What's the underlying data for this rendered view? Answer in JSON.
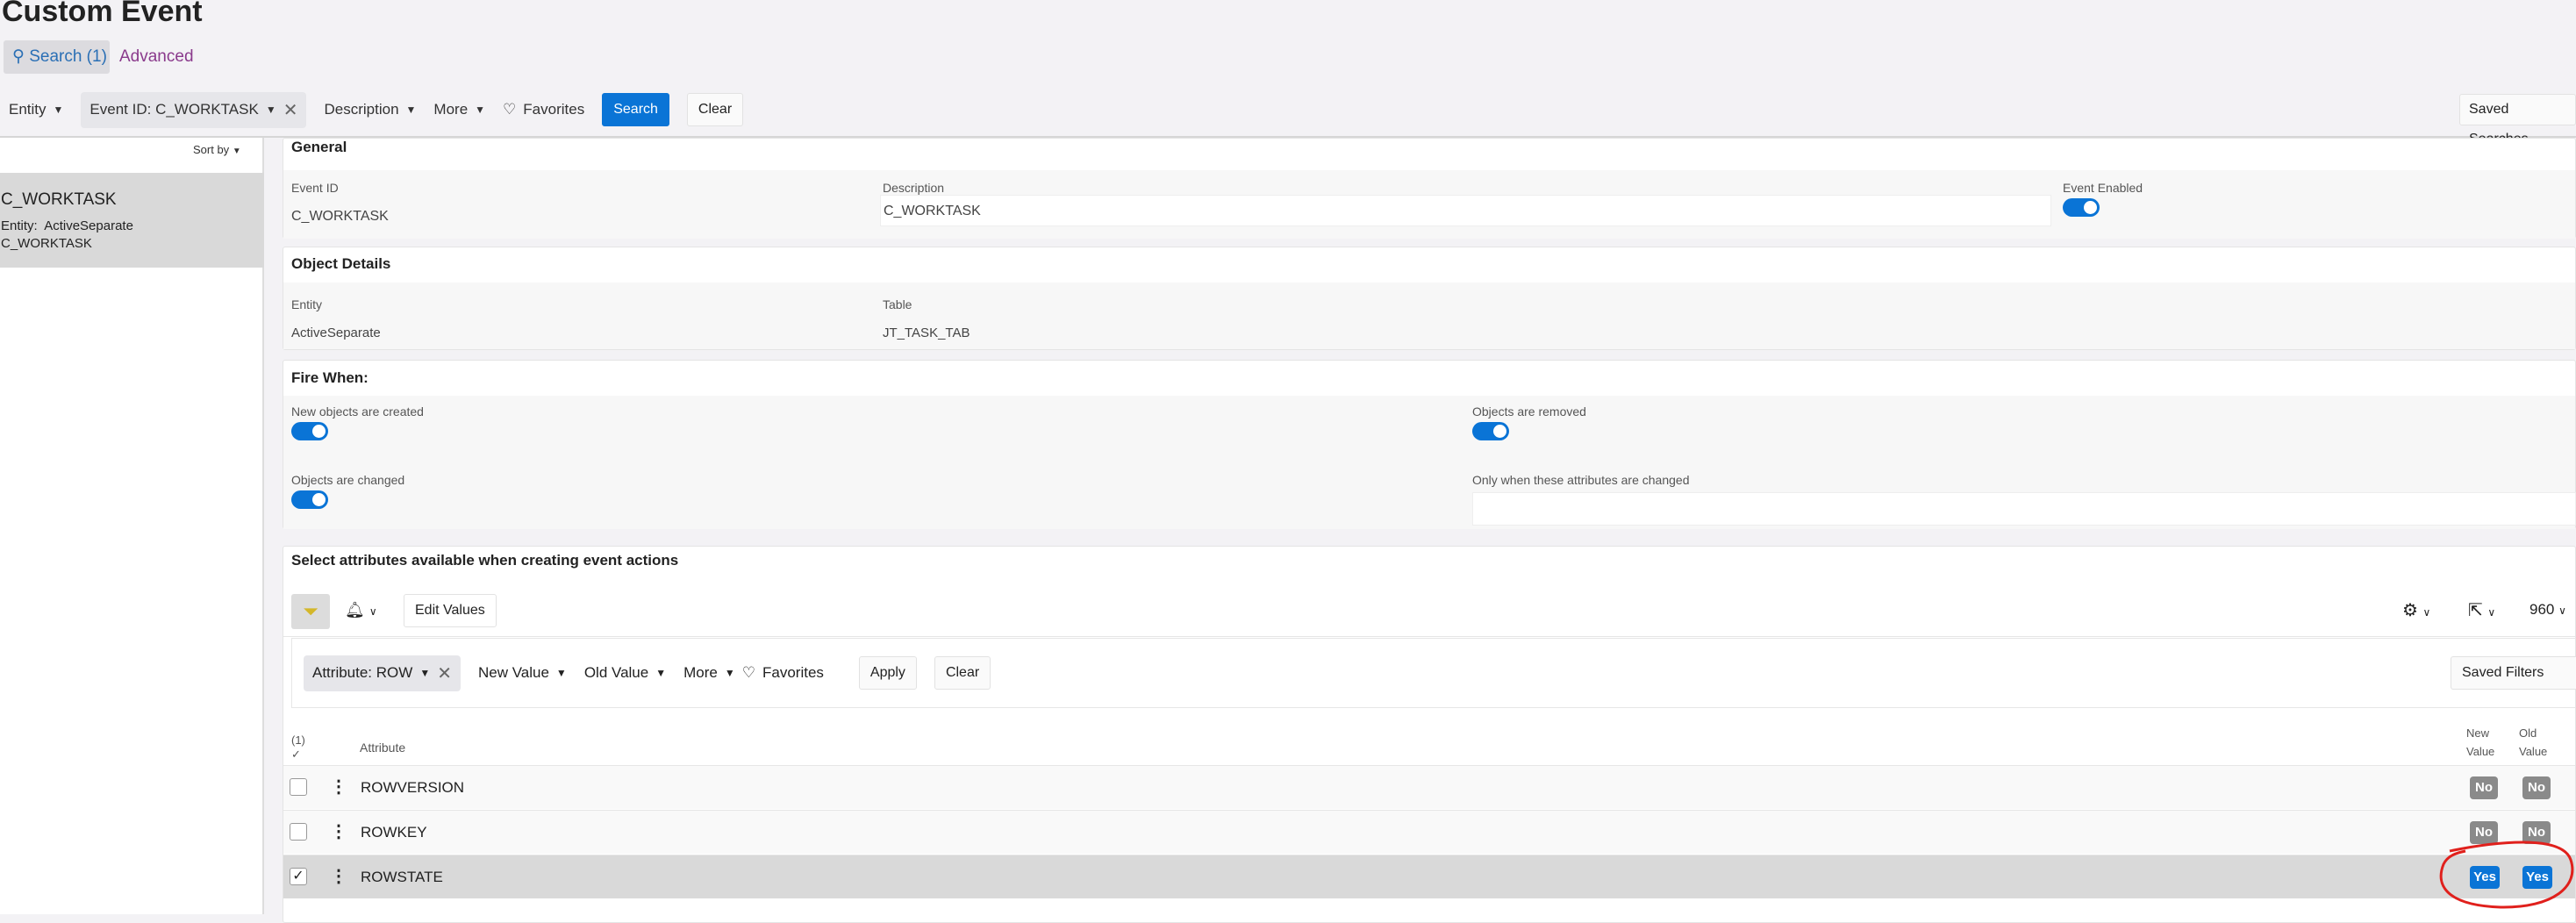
{
  "page_title": "Custom Event",
  "tabs": {
    "search": "Search (1)",
    "advanced": "Advanced"
  },
  "filter_bar": {
    "entity": "Entity",
    "event_id": "Event ID: C_WORKTASK",
    "description": "Description",
    "more": "More",
    "favorites": "Favorites",
    "search": "Search",
    "clear": "Clear",
    "saved_searches": "Saved Searches"
  },
  "list": {
    "sort_by": "Sort by",
    "items": [
      {
        "title": "C_WORKTASK",
        "entity_label": "Entity:",
        "entity": "ActiveSeparate",
        "sub": "C_WORKTASK"
      }
    ]
  },
  "general": {
    "header": "General",
    "event_id_label": "Event ID",
    "event_id": "C_WORKTASK",
    "description_label": "Description",
    "description": "C_WORKTASK",
    "enabled_label": "Event Enabled",
    "enabled": true
  },
  "object_details": {
    "header": "Object Details",
    "entity_label": "Entity",
    "entity": "ActiveSeparate",
    "table_label": "Table",
    "table": "JT_TASK_TAB"
  },
  "fire_when": {
    "header": "Fire When:",
    "created_label": "New objects are created",
    "created": true,
    "removed_label": "Objects are removed",
    "removed": true,
    "changed_label": "Objects are changed",
    "changed": true,
    "only_when_label": "Only when these attributes are changed",
    "only_when": ""
  },
  "attributes": {
    "header": "Select attributes available when creating event actions",
    "edit_values": "Edit Values",
    "page_size": "960",
    "filter_chip": "Attribute: ROW",
    "new_value": "New Value",
    "old_value": "Old Value",
    "more": "More",
    "favorites": "Favorites",
    "apply": "Apply",
    "clear": "Clear",
    "saved_filters": "Saved Filters",
    "selected_count": "(1)",
    "col_attribute": "Attribute",
    "col_new_value": "New Value",
    "col_old_value": "Old Value",
    "rows": [
      {
        "name": "ROWVERSION",
        "new": "No",
        "old": "No",
        "checked": false
      },
      {
        "name": "ROWKEY",
        "new": "No",
        "old": "No",
        "checked": false
      },
      {
        "name": "ROWSTATE",
        "new": "Yes",
        "old": "Yes",
        "checked": true
      }
    ]
  },
  "colors": {
    "primary": "#0a74d6",
    "annotation": "#e0201c"
  }
}
